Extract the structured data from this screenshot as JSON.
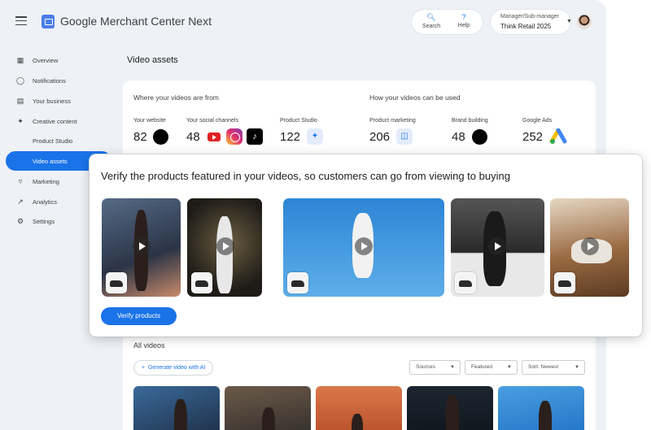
{
  "header": {
    "app_title": "Google Merchant Center Next",
    "search_label": "Search",
    "help_label": "Help",
    "account_role": "Manager/Sub-manager",
    "account_name": "Think Retail 2025"
  },
  "sidebar": {
    "items": [
      {
        "label": "Overview",
        "icon": "overview-icon"
      },
      {
        "label": "Notifications",
        "icon": "bell-icon"
      },
      {
        "label": "Your business",
        "icon": "store-icon"
      },
      {
        "label": "Creative content",
        "icon": "creative-icon"
      },
      {
        "label": "Product Studio",
        "icon": ""
      },
      {
        "label": "Video assets",
        "icon": "",
        "active": true
      },
      {
        "label": "Marketing",
        "icon": "megaphone-icon"
      },
      {
        "label": "Analytics",
        "icon": "trend-icon"
      },
      {
        "label": "Settings",
        "icon": "gear-icon"
      }
    ]
  },
  "page": {
    "title": "Video assets"
  },
  "sources": {
    "heading": "Where your videos are from",
    "items": [
      {
        "label": "Your website",
        "value": "82"
      },
      {
        "label": "Your social channels",
        "value": "48"
      },
      {
        "label": "Product Studio",
        "value": "122"
      }
    ]
  },
  "usage": {
    "heading": "How your videos can be used",
    "items": [
      {
        "label": "Product marketing",
        "value": "206"
      },
      {
        "label": "Brand building",
        "value": "48"
      },
      {
        "label": "Google Ads",
        "value": "252"
      }
    ]
  },
  "modal": {
    "heading": "Verify the products featured in your videos, so customers can go from viewing to buying",
    "button": "Verify products"
  },
  "all_videos": {
    "heading": "All videos",
    "generate_label": "Generate video with AI",
    "filters": [
      "Sources",
      "Featured",
      "Sort: Newest"
    ]
  },
  "colors": {
    "accent": "#1a73e8",
    "background": "#eef1f6"
  }
}
